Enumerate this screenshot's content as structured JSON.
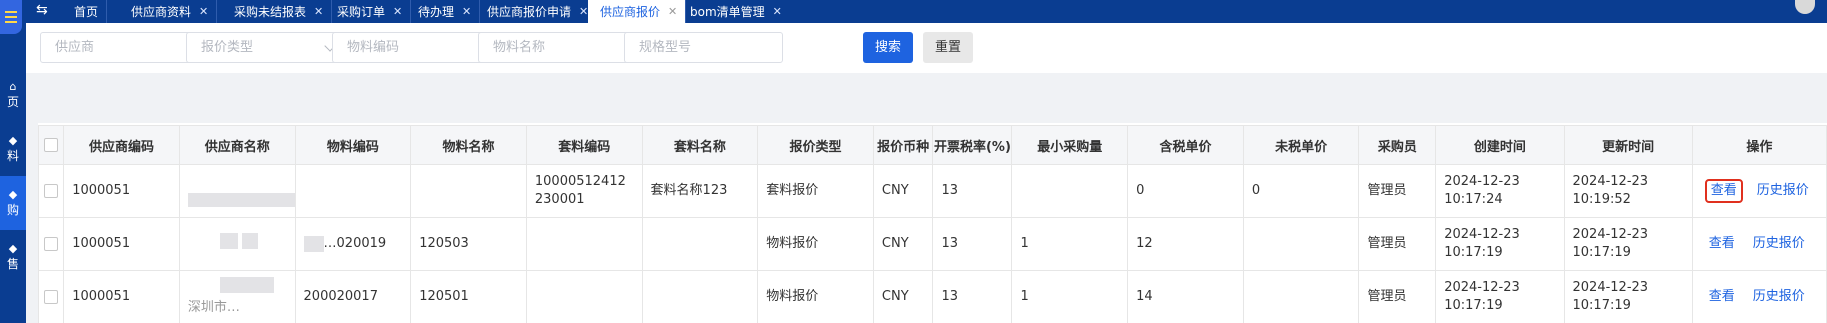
{
  "sidebar": {
    "items": [
      {
        "glyph": "⌂",
        "label": "页"
      },
      {
        "glyph": "◆",
        "label": "料"
      },
      {
        "glyph": "◆",
        "label": "购"
      },
      {
        "glyph": "◆",
        "label": "售"
      }
    ]
  },
  "tabs": [
    {
      "label": "首页",
      "closable": false
    },
    {
      "label": "供应商资料",
      "closable": true
    },
    {
      "label": "采购未结报表",
      "closable": true
    },
    {
      "label": "采购订单",
      "closable": true
    },
    {
      "label": "待办理",
      "closable": true
    },
    {
      "label": "供应商报价申请",
      "closable": true
    },
    {
      "label": "供应商报价",
      "closable": true,
      "active": true
    },
    {
      "label": "bom清单管理",
      "closable": true
    }
  ],
  "filters": {
    "supplier_placeholder": "供应商",
    "quote_type_placeholder": "报价类型",
    "material_code_placeholder": "物料编码",
    "material_name_placeholder": "物料名称",
    "spec_placeholder": "规格型号",
    "search_label": "搜索",
    "reset_label": "重置"
  },
  "table": {
    "headers": [
      "供应商编码",
      "供应商名称",
      "物料编码",
      "物料名称",
      "套料编码",
      "套料名称",
      "报价类型",
      "报价币种",
      "开票税率(%)",
      "最小采购量",
      "含税单价",
      "未税单价",
      "采购员",
      "创建时间",
      "更新时间",
      "操作"
    ],
    "rows": [
      {
        "supplier_code": "1000051",
        "supplier_name": "",
        "material_code": "",
        "material_name": "",
        "kit_code": "10000512412230001",
        "kit_name": "套料名称123",
        "quote_type": "套料报价",
        "currency": "CNY",
        "tax_rate": "13",
        "min_qty": "",
        "price_with_tax": "0",
        "price_without_tax": "0",
        "buyer": "管理员",
        "created": "2024-12-23 10:17:24",
        "updated": "2024-12-23 10:19:52",
        "view": "查看",
        "history": "历史报价"
      },
      {
        "supplier_code": "1000051",
        "supplier_name": "",
        "material_code": "…020019",
        "material_name": "120503",
        "kit_code": "",
        "kit_name": "",
        "quote_type": "物料报价",
        "currency": "CNY",
        "tax_rate": "13",
        "min_qty": "1",
        "price_with_tax": "12",
        "price_without_tax": "",
        "buyer": "管理员",
        "created": "2024-12-23 10:17:19",
        "updated": "2024-12-23 10:17:19",
        "view": "查看",
        "history": "历史报价"
      },
      {
        "supplier_code": "1000051",
        "supplier_name": "深圳市…",
        "material_code": "200020017",
        "material_name": "120501",
        "kit_code": "",
        "kit_name": "",
        "quote_type": "物料报价",
        "currency": "CNY",
        "tax_rate": "13",
        "min_qty": "1",
        "price_with_tax": "14",
        "price_without_tax": "",
        "buyer": "管理员",
        "created": "2024-12-23 10:17:19",
        "updated": "2024-12-23 10:17:19",
        "view": "查看",
        "history": "历史报价"
      }
    ]
  },
  "colors": {
    "primary": "#1e63e0",
    "nav": "#0a3d91",
    "highlight": "#e0301e"
  }
}
